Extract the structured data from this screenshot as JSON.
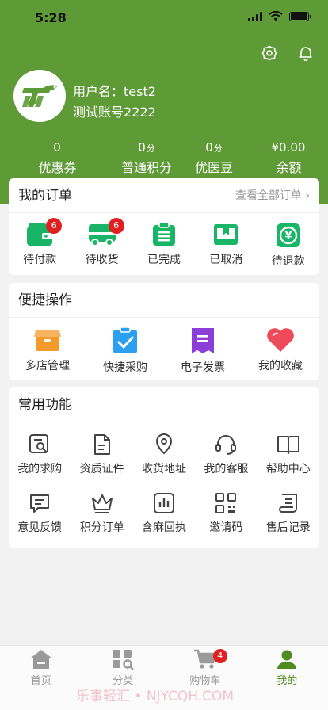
{
  "status": {
    "time": "5:28"
  },
  "user": {
    "name_line": "用户名：test2",
    "account_line": "测试账号2222"
  },
  "stats": [
    {
      "value": "0",
      "unit": "",
      "label": "优惠券"
    },
    {
      "value": "0",
      "unit": "分",
      "label": "普通积分"
    },
    {
      "value": "0",
      "unit": "分",
      "label": "优医豆"
    },
    {
      "value": "¥0.00",
      "unit": "",
      "label": "余额"
    }
  ],
  "orders": {
    "title": "我的订单",
    "more": "查看全部订单 ›",
    "items": [
      {
        "label": "待付款",
        "badge": "6",
        "icon": "wallet-icon"
      },
      {
        "label": "待收货",
        "badge": "6",
        "icon": "truck-icon"
      },
      {
        "label": "已完成",
        "badge": "",
        "icon": "clipboard-icon"
      },
      {
        "label": "已取消",
        "badge": "",
        "icon": "cancel-box-icon"
      },
      {
        "label": "待退款",
        "badge": "",
        "icon": "refund-icon"
      }
    ]
  },
  "quick": {
    "title": "便捷操作",
    "items": [
      {
        "label": "多店管理",
        "icon": "store-icon"
      },
      {
        "label": "快捷采购",
        "icon": "checklist-icon"
      },
      {
        "label": "电子发票",
        "icon": "invoice-icon"
      },
      {
        "label": "我的收藏",
        "icon": "heart-icon"
      }
    ]
  },
  "common": {
    "title": "常用功能",
    "row1": [
      {
        "label": "我的求购",
        "icon": "search-doc-icon"
      },
      {
        "label": "资质证件",
        "icon": "certificate-icon"
      },
      {
        "label": "收货地址",
        "icon": "location-icon"
      },
      {
        "label": "我的客服",
        "icon": "headset-icon"
      },
      {
        "label": "帮助中心",
        "icon": "book-icon"
      }
    ],
    "row2": [
      {
        "label": "意见反馈",
        "icon": "feedback-icon"
      },
      {
        "label": "积分订单",
        "icon": "crown-icon"
      },
      {
        "label": "含麻回执",
        "icon": "chart-icon"
      },
      {
        "label": "邀请码",
        "icon": "qrcode-icon"
      },
      {
        "label": "售后记录",
        "icon": "scroll-icon"
      }
    ]
  },
  "tabs": [
    {
      "label": "首页",
      "icon": "home-icon",
      "badge": ""
    },
    {
      "label": "分类",
      "icon": "category-icon",
      "badge": ""
    },
    {
      "label": "购物车",
      "icon": "cart-icon",
      "badge": "4"
    },
    {
      "label": "我的",
      "icon": "user-icon",
      "badge": ""
    }
  ],
  "watermark": "乐事轻汇 • NJYCQH.COM",
  "colors": {
    "brand": "#5e9a36",
    "orange": "#f39a2b",
    "blue": "#2ba0f0",
    "purple": "#8c3fd6",
    "red": "#ef4a5a",
    "green": "#18b566"
  }
}
